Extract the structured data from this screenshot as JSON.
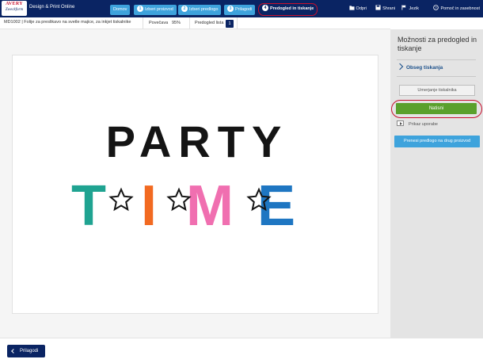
{
  "header": {
    "logo_top": "AVERY",
    "logo_bottom": "Zweckform",
    "app_title": "Design & Print Online",
    "steps": [
      {
        "label": "Domov",
        "number": ""
      },
      {
        "label": "Izberi proizvod",
        "number": "1"
      },
      {
        "label": "Izberi predlogo",
        "number": "2"
      },
      {
        "label": "Prilagodi",
        "number": "3"
      },
      {
        "label": "Predogled in tiskanje",
        "number": "4"
      }
    ],
    "actions": {
      "open": "Odpri",
      "save": "Shrani",
      "language": "Jezik",
      "help": "Pomoč in zasebnost"
    }
  },
  "subbar": {
    "product": "MD1002 | Folije za preslikavo na svetle majice, za inkjet tiskalnike",
    "zoom_label": "Povečava",
    "zoom_value": "95%",
    "sheet_label": "Predogled lista",
    "sheet_number": "1"
  },
  "artwork": {
    "line1": "PARTY",
    "line2_letters": [
      "T",
      "I",
      "M",
      "E"
    ],
    "colors": {
      "party": "#141414",
      "t": "#1fa391",
      "i": "#f26a21",
      "m": "#f06fb0",
      "e": "#1e76c2"
    }
  },
  "sidebar": {
    "title": "Možnosti za predogled in tiskanje",
    "print_scope": "Obseg tiskanja",
    "printer_settings": "Umerjanje tiskalnika",
    "print": "Natisni",
    "video": "Prikaz uporabe",
    "transfer": "Prenesi predlogo na drug proizvod"
  },
  "footer": {
    "back": "Prilagodi"
  },
  "colors": {
    "navy": "#0a2463",
    "step_blue": "#3ea3dc",
    "print_green": "#5aa02c",
    "highlight_red": "#c8102e"
  }
}
